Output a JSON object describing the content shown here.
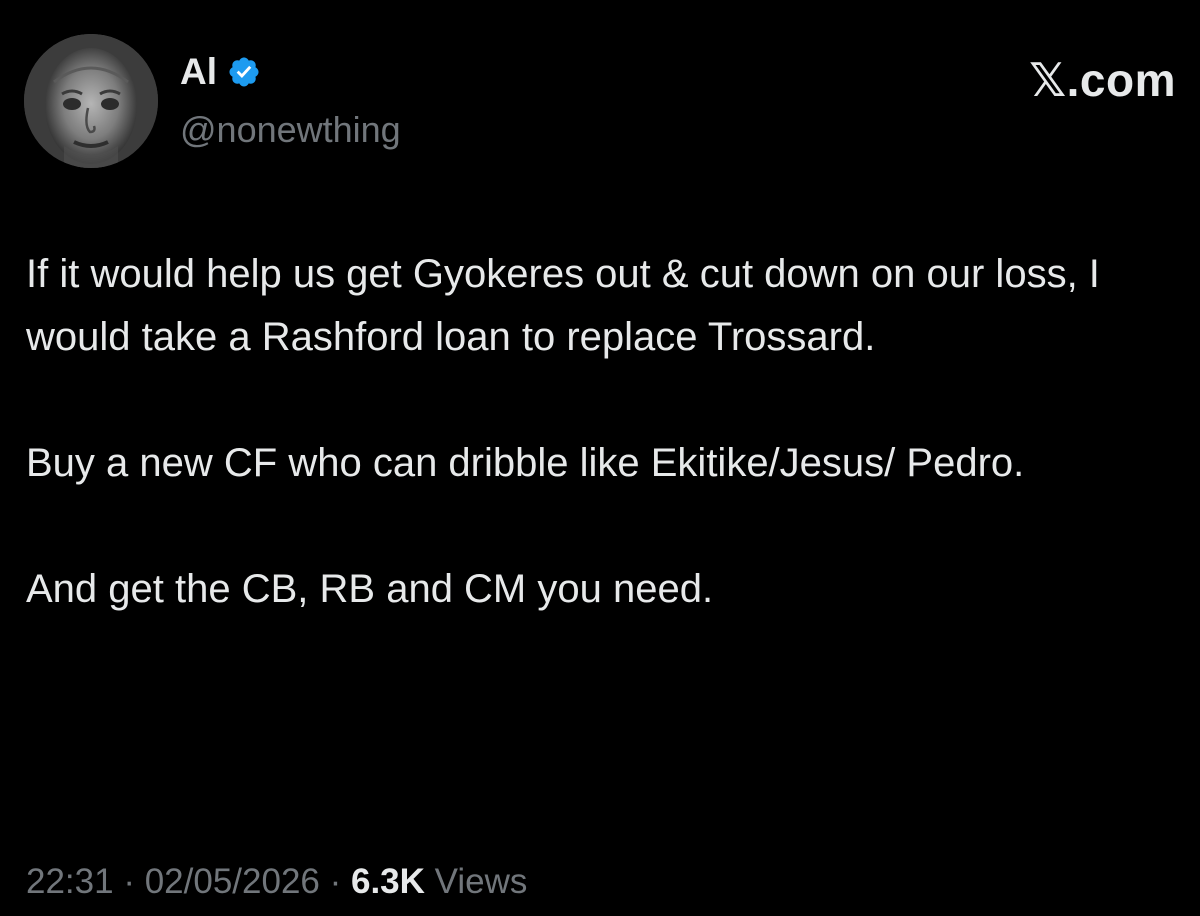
{
  "author": {
    "display_name": "Al",
    "handle": "@nonewthing",
    "verified_color": "#1d9bf0",
    "avatar_icon": "profile-photo"
  },
  "brand": {
    "label": "𝕏.com"
  },
  "tweet": {
    "paragraphs": [
      "If it would help us get Gyokeres out & cut down on our loss, I would take a Rashford loan to replace Trossard.",
      "Buy a new CF who can dribble like Ekitike/Jesus/ Pedro.",
      "And get the CB, RB and CM you need."
    ]
  },
  "meta": {
    "time": "22:31",
    "separator": " · ",
    "date": "02/05/2026",
    "views_count": "6.3K",
    "views_label": "Views"
  },
  "colors": {
    "background": "#000000",
    "text_primary": "#e7e9ea",
    "text_secondary": "#71767b"
  }
}
